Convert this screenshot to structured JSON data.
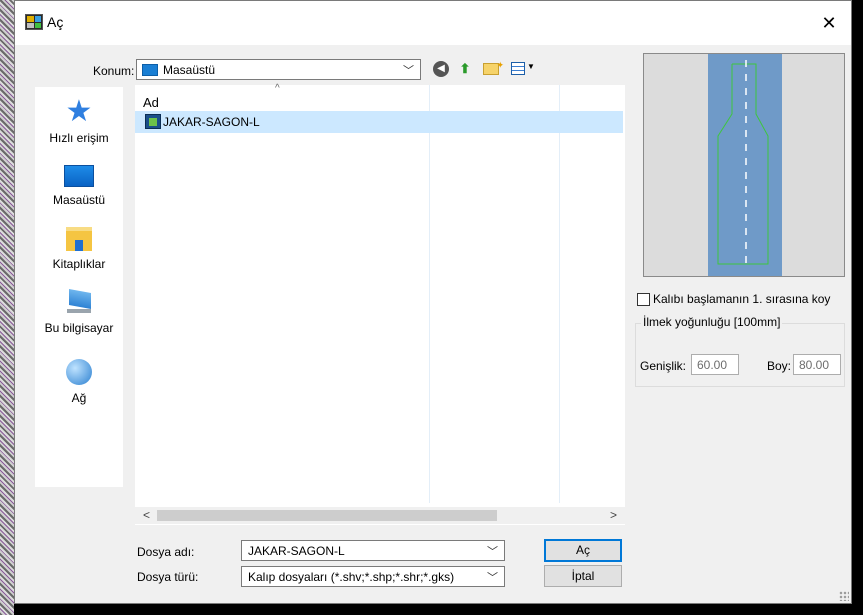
{
  "window": {
    "title": "Aç",
    "close_glyph": "✕"
  },
  "toolbar": {
    "location_label": "Konum:",
    "location_value": "Masaüstü",
    "back_icon": "back-arrow-icon",
    "up_icon": "up-folder-icon",
    "new_folder_icon": "new-folder-icon",
    "view_icon": "view-menu-icon"
  },
  "places": [
    {
      "label": "Hızlı erişim",
      "icon": "quick-access-star-icon"
    },
    {
      "label": "Masaüstü",
      "icon": "desktop-icon"
    },
    {
      "label": "Kitaplıklar",
      "icon": "libraries-icon"
    },
    {
      "label": "Bu bilgisayar",
      "icon": "this-pc-icon"
    },
    {
      "label": "Ağ",
      "icon": "network-icon"
    }
  ],
  "file_list": {
    "column_header": "Ad",
    "items": [
      {
        "name": "JAKAR-SAGON-L",
        "selected": true
      }
    ]
  },
  "footer": {
    "filename_label": "Dosya adı:",
    "filename_value": "JAKAR-SAGON-L",
    "filetype_label": "Dosya türü:",
    "filetype_value": "Kalıp dosyaları (*.shv;*.shp;*.shr;*.gks)",
    "open_label": "Aç",
    "cancel_label": "İptal"
  },
  "options": {
    "start_checkbox_label": "Kalıbı başlamanın 1. sırasına koy",
    "start_checked": false,
    "loop_density_title": "İlmek yoğunluğu [100mm]",
    "width_label": "Genişlik:",
    "width_value": "60.00",
    "height_label": "Boy:",
    "height_value": "80.00"
  },
  "colors": {
    "selection": "#cce8ff",
    "preview_road": "#6f9ac8",
    "preview_bg": "#dcdcdc",
    "preview_outline": "#3ec63e"
  }
}
